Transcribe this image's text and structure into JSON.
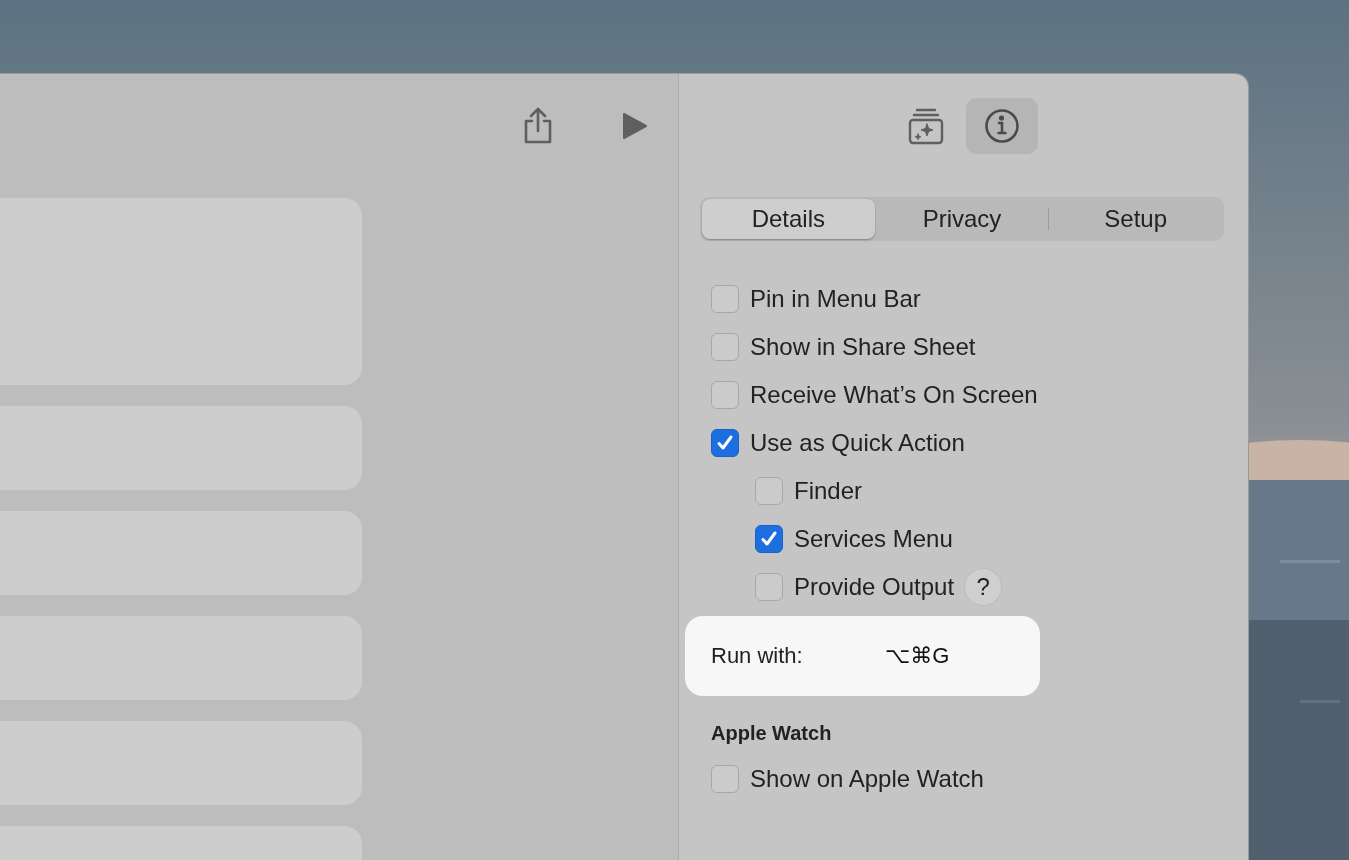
{
  "inspector_buttons": [
    {
      "kind": "gallery",
      "selected": false
    },
    {
      "kind": "info",
      "selected": true
    }
  ],
  "tabs": [
    {
      "label": "Details",
      "selected": true
    },
    {
      "label": "Privacy",
      "selected": false
    },
    {
      "label": "Setup",
      "selected": false
    }
  ],
  "options": [
    {
      "label": "Pin in Menu Bar",
      "checked": false
    },
    {
      "label": "Show in Share Sheet",
      "checked": false
    },
    {
      "label": "Receive What’s On Screen",
      "checked": false
    },
    {
      "label": "Use as Quick Action",
      "checked": true,
      "children": [
        {
          "label": "Finder",
          "checked": false
        },
        {
          "label": "Services Menu",
          "checked": true
        },
        {
          "label": "Provide Output",
          "checked": false,
          "help": "?"
        }
      ]
    }
  ],
  "run_with": {
    "label": "Run with:",
    "shortcut": "⌥⌘G"
  },
  "apple_watch": {
    "title": "Apple Watch",
    "options": [
      {
        "label": "Show on Apple Watch",
        "checked": false
      }
    ]
  }
}
